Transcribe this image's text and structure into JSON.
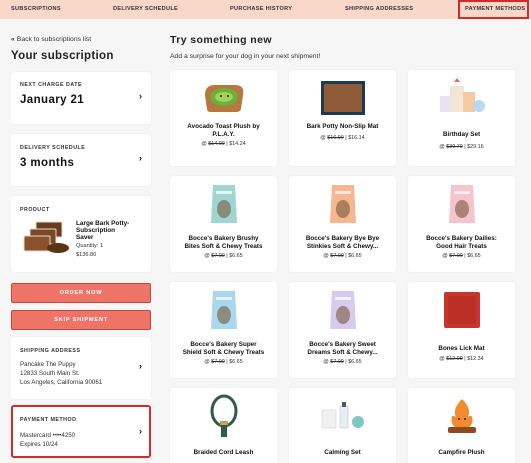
{
  "nav": {
    "items": [
      "SUBSCRIPTIONS",
      "DELIVERY SCHEDULE",
      "PURCHASE HISTORY",
      "SHIPPING ADDRESSES",
      "PAYMENT METHODS"
    ],
    "active": "PAYMENT METHODS",
    "highlight_color": "#d42a2a",
    "background_color": "#f9d8c9"
  },
  "sidebar": {
    "back_link": "Back to subscriptions list",
    "title": "Your subscription",
    "next_charge": {
      "label": "NEXT CHARGE DATE",
      "value": "January 21"
    },
    "delivery": {
      "label": "DELIVERY SCHEDULE",
      "value": "3 months"
    },
    "product": {
      "label": "PRODUCT",
      "name_line1": "Large Bark Potty-",
      "name_line2": "Subscription",
      "name_line3": "Saver",
      "quantity": "Quantity: 1",
      "price": "$136.80"
    },
    "order_now": "ORDER NOW",
    "skip_shipment": "SKIP SHIPMENT",
    "shipping": {
      "label": "SHIPPING ADDRESS",
      "line1": "Pancake The Puppy",
      "line2": "12833 South Main St.",
      "line3": "Los Angeles, California 90061"
    },
    "payment": {
      "label": "PAYMENT METHOD",
      "card": "Mastercard ••••4250",
      "expires": "Expires 10/24"
    },
    "button_color": "#ee7467"
  },
  "main": {
    "title": "Try something new",
    "subtitle": "Add a surprise for your dog in your next shipment!",
    "products": [
      {
        "line1": "Avocado Toast Plush by",
        "line2": "P.L.A.Y.",
        "old": "$14.99",
        "new": "$14.24",
        "icon": "avocado-toast-plush-image"
      },
      {
        "line1": "Bark Potty Non-Slip Mat",
        "line2": "",
        "old": "$16.99",
        "new": "$16.14",
        "icon": "non-slip-mat-image"
      },
      {
        "line1": "Birthday Set",
        "line2": "",
        "old": "$30.70",
        "new": "$29.16",
        "icon": "birthday-set-image"
      },
      {
        "line1": "Bocce's Bakery Brushy",
        "line2": "Bites Soft & Chewy Treats",
        "old": "$7.00",
        "new": "$6.65",
        "icon": "treat-bag-teal-image"
      },
      {
        "line1": "Bocce's Bakery Bye Bye",
        "line2": "Stinkies Soft & Chewy...",
        "old": "$7.00",
        "new": "$6.65",
        "icon": "treat-bag-peach-image"
      },
      {
        "line1": "Bocce's Bakery Dailies:",
        "line2": "Good Hair Treats",
        "old": "$7.00",
        "new": "$6.65",
        "icon": "treat-bag-pink-image"
      },
      {
        "line1": "Bocce's Bakery Super",
        "line2": "Shield Soft & Chewy Treats",
        "old": "$7.00",
        "new": "$6.65",
        "icon": "treat-bag-blue-image"
      },
      {
        "line1": "Bocce's Bakery Sweet",
        "line2": "Dreams Soft & Chewy...",
        "old": "$7.00",
        "new": "$6.65",
        "icon": "treat-bag-lavender-image"
      },
      {
        "line1": "Bones Lick Mat",
        "line2": "",
        "old": "$12.99",
        "new": "$12.34",
        "icon": "lick-mat-image"
      },
      {
        "line1": "Braided Cord Leash",
        "line2": "",
        "old": "",
        "new": "",
        "icon": "leash-image"
      },
      {
        "line1": "Calming Set",
        "line2": "",
        "old": "",
        "new": "",
        "icon": "calming-set-image"
      },
      {
        "line1": "Campfire Plush",
        "line2": "",
        "old": "",
        "new": "",
        "icon": "campfire-plush-image"
      }
    ]
  }
}
